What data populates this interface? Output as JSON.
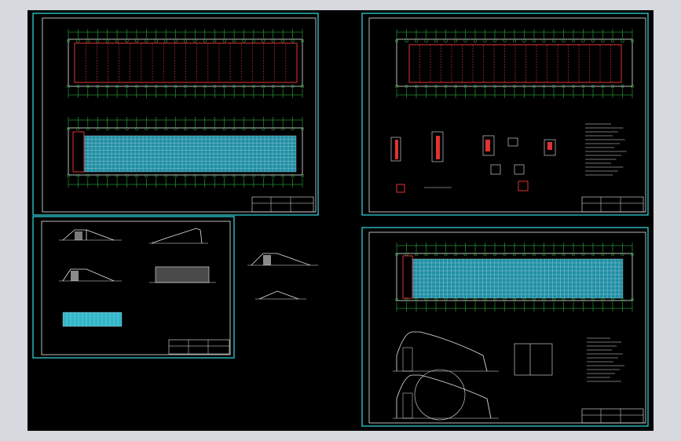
{
  "canvas": {
    "background_color": "#000000",
    "frame_color": "#d6d9de",
    "border_color": "#33e0e6",
    "grid_color": "#2fd04a",
    "wall_color": "#e23232",
    "glazing_color": "#2fb6c9",
    "line_color": "#e8e8e8"
  },
  "sheets": [
    {
      "id": "sheet-1",
      "content": "plans-and-elevation"
    },
    {
      "id": "sheet-2",
      "content": "sections"
    },
    {
      "id": "sheet-3",
      "content": "foundation-plan-and-details"
    },
    {
      "id": "sheet-4",
      "content": "elevation-and-arch-sections"
    }
  ]
}
